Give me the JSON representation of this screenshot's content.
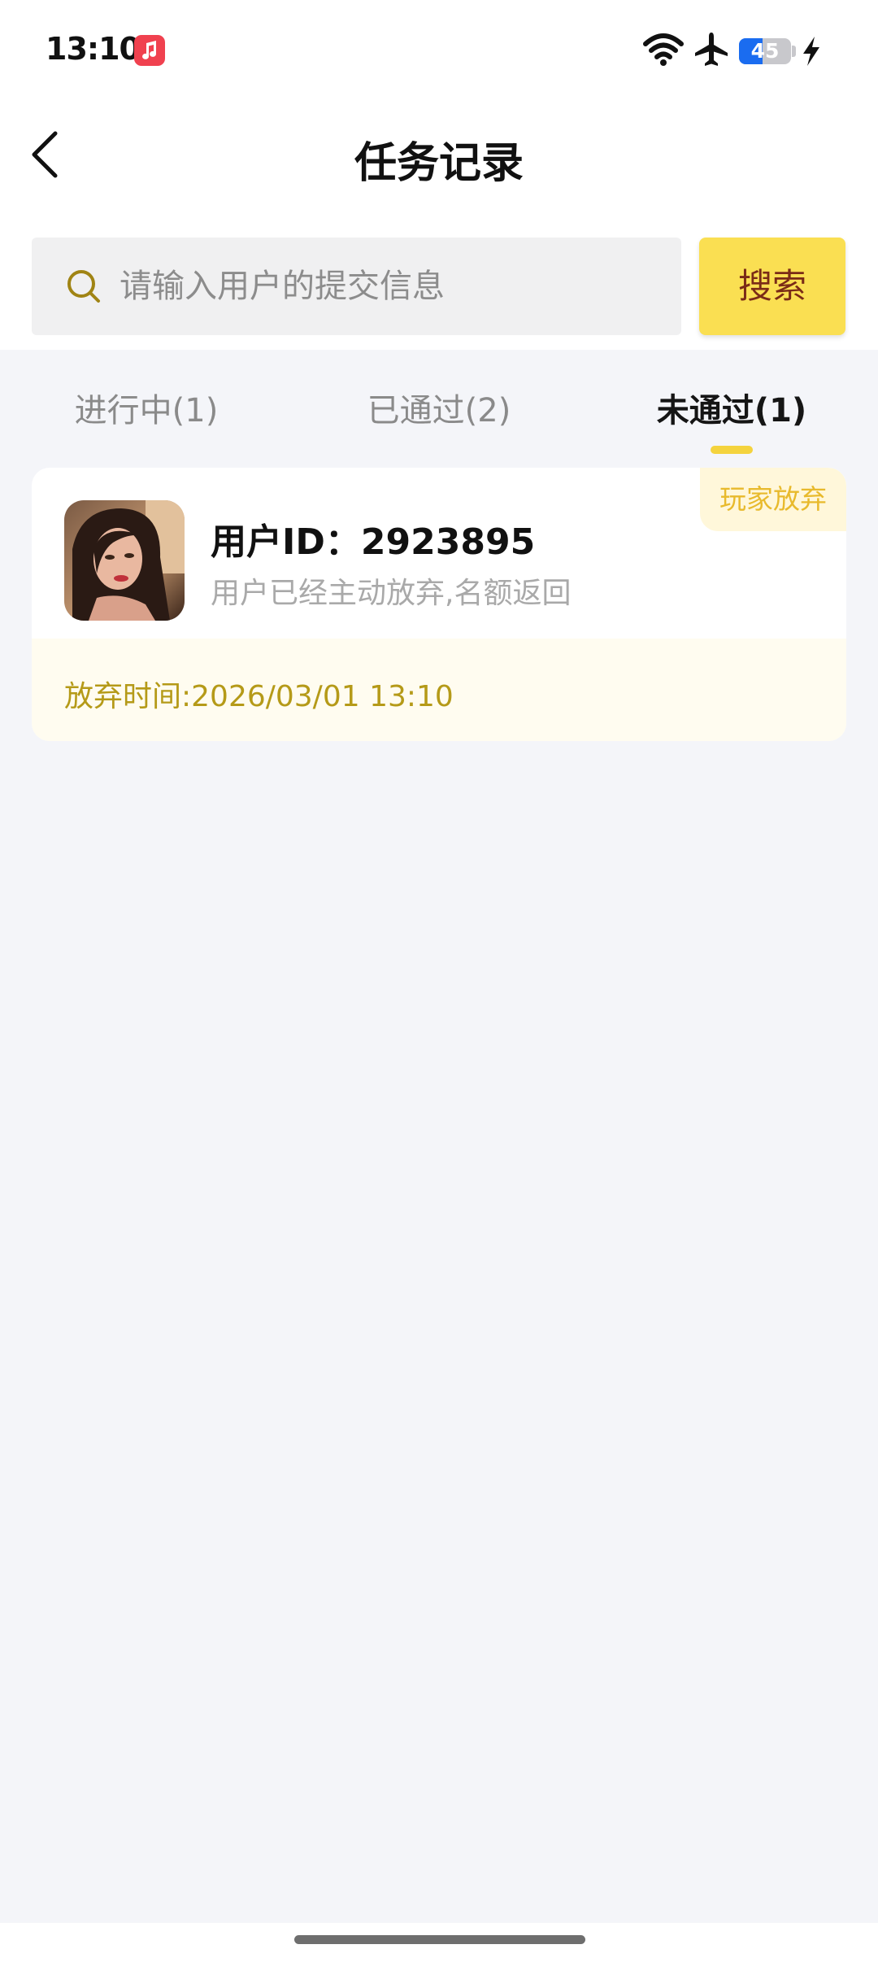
{
  "status_bar": {
    "time": "13:10",
    "battery": "45",
    "battery_level": 0.45,
    "icons": [
      "music-app-icon",
      "wifi-icon",
      "airplane-mode-icon",
      "battery-icon",
      "charging-icon"
    ]
  },
  "header": {
    "title": "任务记录",
    "back_icon": "chevron-left-icon"
  },
  "search": {
    "placeholder": "请输入用户的提交信息",
    "button_label": "搜索",
    "icon": "search-icon"
  },
  "tabs": [
    {
      "label": "进行中(1)",
      "active": false
    },
    {
      "label": "已通过(2)",
      "active": false
    },
    {
      "label": "未通过(1)",
      "active": true
    }
  ],
  "records": [
    {
      "status_tag": "玩家放弃",
      "user_id": "用户ID：2923895",
      "description": "用户已经主动放弃,名额返回",
      "abandon_time": "放弃时间:2026/03/01 13:10"
    }
  ],
  "colors": {
    "accent_yellow": "#fadf52",
    "tab_indicator": "#f4d33e",
    "tag_text": "#e8ba2c",
    "time_text": "#b59a18",
    "search_button_text": "#7a2b17",
    "page_background": "#f4f5f9"
  }
}
